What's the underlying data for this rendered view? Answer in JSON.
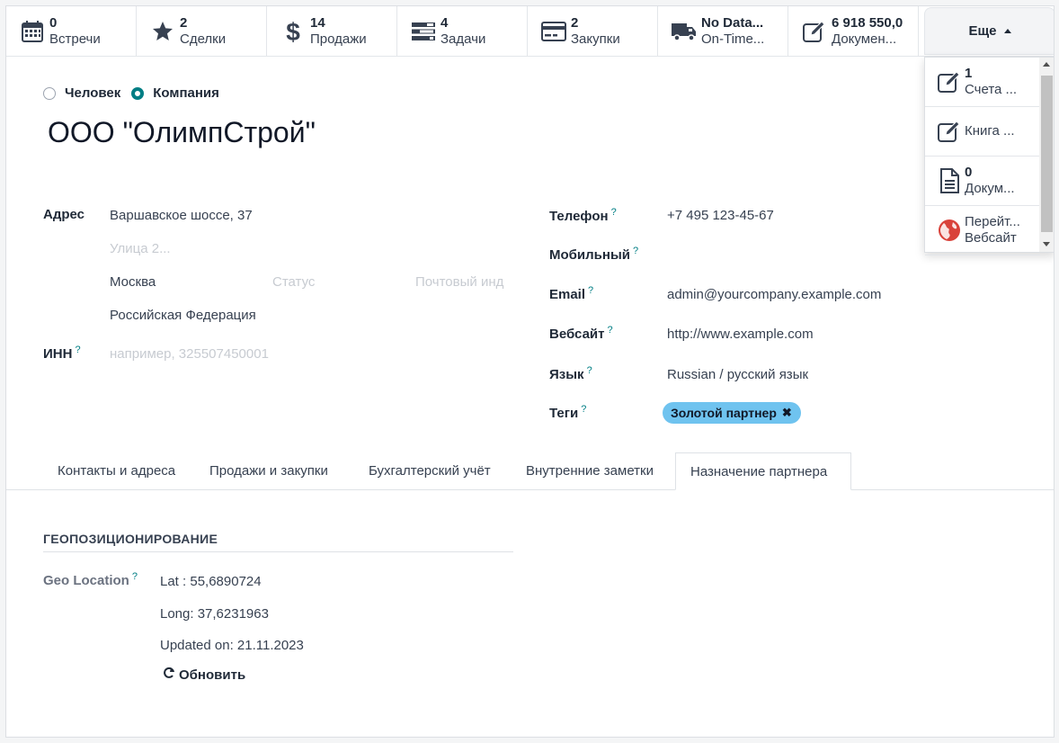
{
  "smart_buttons": [
    {
      "value": "0",
      "label": "Встречи",
      "icon": "calendar-icon"
    },
    {
      "value": "2",
      "label": "Сделки",
      "icon": "star-icon"
    },
    {
      "value": "14",
      "label": "Продажи",
      "icon": "dollar-icon"
    },
    {
      "value": "4",
      "label": "Задачи",
      "icon": "tasks-icon"
    },
    {
      "value": "2",
      "label": "Закупки",
      "icon": "credit-card-icon"
    },
    {
      "value": "No Data...",
      "label": "On-Time...",
      "icon": "truck-icon"
    },
    {
      "value": "6 918 550,0",
      "label": "Докумен...",
      "icon": "edit-icon"
    }
  ],
  "more_label": "Еще",
  "dropdown": [
    {
      "value": "1",
      "label": "Счета ...",
      "icon": "edit-icon"
    },
    {
      "value": "",
      "label": "Книга ...",
      "icon": "edit-icon"
    },
    {
      "value": "0",
      "label": "Докум...",
      "icon": "document-icon"
    },
    {
      "value": "Перейт...",
      "label": "Вебсайт",
      "icon": "globe-icon"
    }
  ],
  "radio": {
    "person": "Человек",
    "company": "Компания",
    "selected": "company"
  },
  "title": "ООО \"ОлимпСтрой\"",
  "address": {
    "label": "Адрес",
    "street": "Варшавское шоссе, 37",
    "street2_placeholder": "Улица 2...",
    "city": "Москва",
    "state_placeholder": "Статус",
    "zip_placeholder": "Почтовый инд",
    "country": "Российская Федерация"
  },
  "inn": {
    "label": "ИНН",
    "placeholder": "например, 325507450001"
  },
  "contact": {
    "phone_label": "Телефон",
    "phone": "+7 495 123-45-67",
    "mobile_label": "Мобильный",
    "email_label": "Email",
    "email": "admin@yourcompany.example.com",
    "website_label": "Вебсайт",
    "website": "http://www.example.com",
    "lang_label": "Язык",
    "lang": "Russian / русский язык",
    "tags_label": "Теги",
    "tag": "Золотой партнер"
  },
  "help_mark": "?",
  "tabs": [
    "Контакты и адреса",
    "Продажи и закупки",
    "Бухгалтерский учёт",
    "Внутренние заметки",
    "Назначение партнера"
  ],
  "active_tab": 4,
  "geo": {
    "section": "ГЕОПОЗИЦИОНИРОВАНИЕ",
    "label": "Geo Location",
    "lat": "Lat :  55,6890724",
    "long": "Long:  37,6231963",
    "updated": "Updated on: 21.11.2023",
    "refresh": "Обновить"
  }
}
